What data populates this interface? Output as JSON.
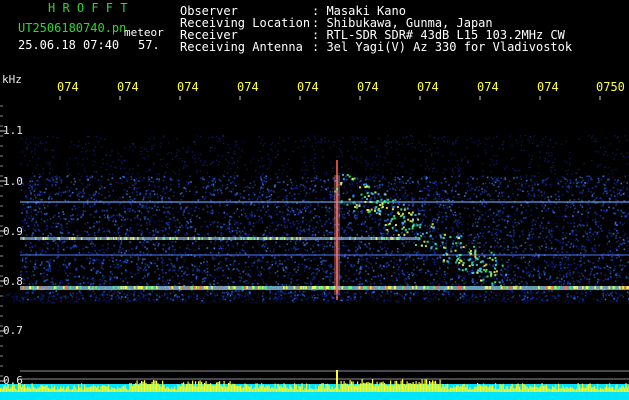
{
  "header": {
    "app_name": "H R O F F T",
    "file_name": "UT2506180740.pn",
    "file_tag": "meteor",
    "date_time": "25.06.18 07:40",
    "count": "57.",
    "fields": [
      {
        "label": "Observer",
        "value": ": Masaki Kano"
      },
      {
        "label": "Receiving Location",
        "value": ": Shibukawa, Gunma, Japan"
      },
      {
        "label": "Receiver",
        "value": ": RTL-SDR SDR# 43dB L15 103.2MHz CW"
      },
      {
        "label": "Receiving Antenna",
        "value": ": 3el Yagi(V) Az 330 for Vladivostok"
      }
    ]
  },
  "time_axis": {
    "labels": [
      "074",
      "074",
      "074",
      "074",
      "074",
      "074",
      "074",
      "074",
      "074",
      "0750"
    ]
  },
  "freq_axis": {
    "unit": "kHz",
    "labels": [
      "1.1",
      "1.0",
      "0.9",
      "0.8",
      "0.7",
      "0.6"
    ]
  },
  "colors": {
    "header_green": "#2fd62f",
    "header_white": "#ffffff",
    "time_labels": "#ffff40",
    "noise_blue": "#1533c8",
    "signal_yellow": "#ffff00",
    "baseline_cyan": "#00e5ff"
  }
}
